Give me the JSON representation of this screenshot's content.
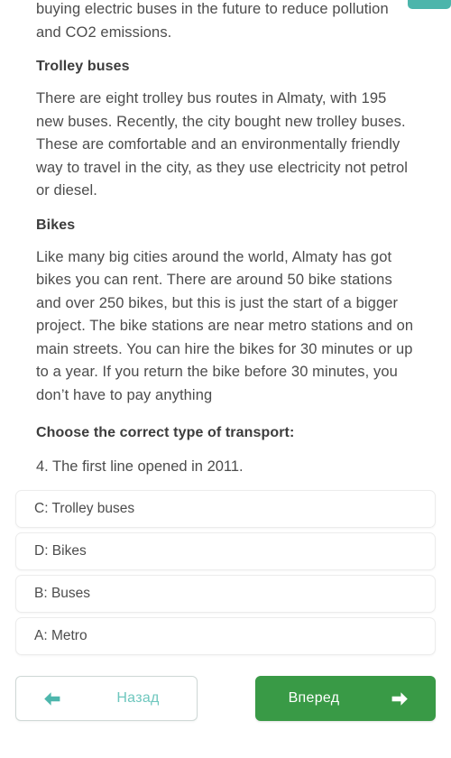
{
  "accent": {
    "teal": "#4cb5ab",
    "teal_text": "#6ec7be",
    "green": "#399a46",
    "body_text": "#4c4c4c",
    "heading_text": "#3c3c3c",
    "card_border": "#ececec"
  },
  "top_tab": {
    "name": "progress-tab-fragment"
  },
  "article": {
    "intro_paragraph": "buying electric buses in the future to reduce pollution and CO2 emissions.",
    "sections": [
      {
        "heading": "Trolley buses",
        "body": "There are eight trolley bus routes in Almaty, with 195 new buses. Recently, the city bought new trolley buses. These are comfortable and an environmentally friendly way to travel in the city, as they use electricity not petrol or diesel."
      },
      {
        "heading": "Bikes",
        "body": "Like many big cities around the world, Almaty has got bikes you can rent. There are around 50 bike stations and over 250 bikes, but this is just the start of a bigger project. The bike stations are near metro stations and on main streets. You can hire the bikes for 30 minutes or up to a year. If you return the bike before 30 minutes, you don’t have to pay anything"
      }
    ]
  },
  "exercise": {
    "prompt": "Choose the correct type of transport:",
    "question": "4. The first line opened in 2011.",
    "options": [
      {
        "label": "C: Trolley buses"
      },
      {
        "label": "D: Bikes"
      },
      {
        "label": "B: Buses"
      },
      {
        "label": "A: Metro"
      }
    ]
  },
  "footer": {
    "back_label": "Назад",
    "back_icon": "arrow-left-icon",
    "forward_label": "Вперед",
    "forward_icon": "arrow-right-icon"
  }
}
